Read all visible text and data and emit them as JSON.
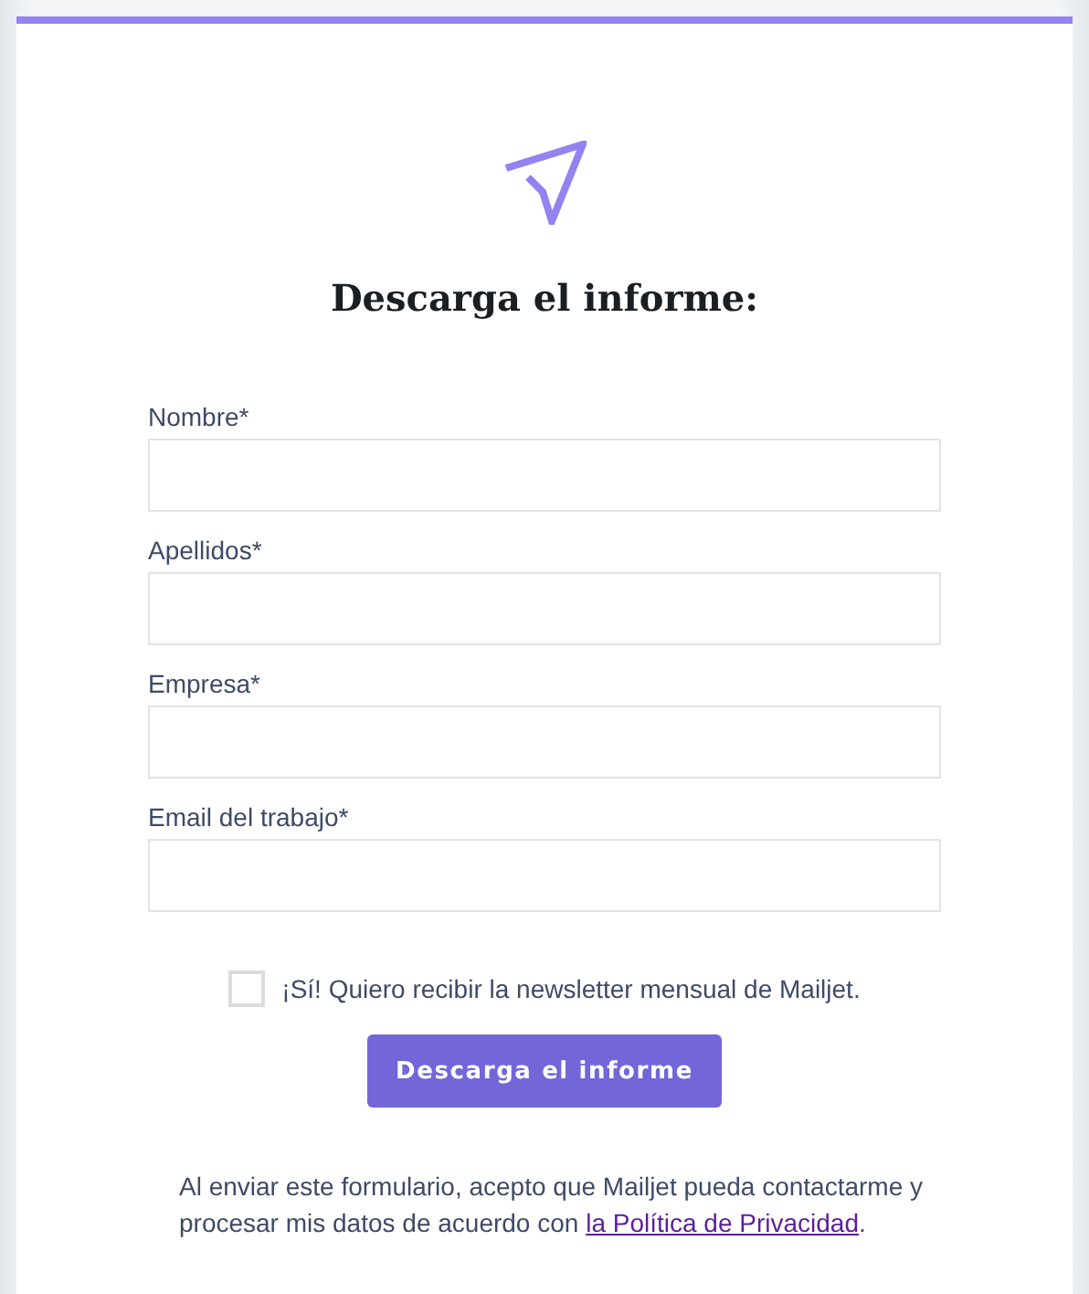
{
  "title": "Descarga el informe:",
  "fields": [
    {
      "label": "Nombre*"
    },
    {
      "label": "Apellidos*"
    },
    {
      "label": "Empresa*"
    },
    {
      "label": "Email del trabajo*"
    }
  ],
  "newsletter": {
    "label": "¡Sí! Quiero recibir la newsletter mensual de Mailjet.",
    "checked": false
  },
  "submit": "Descarga el informe",
  "consent": {
    "text": "Al enviar este formulario, acepto que Mailjet pueda contactarme y procesar mis datos de acuerdo con ",
    "link": "la Política de Privacidad",
    "after": "."
  }
}
